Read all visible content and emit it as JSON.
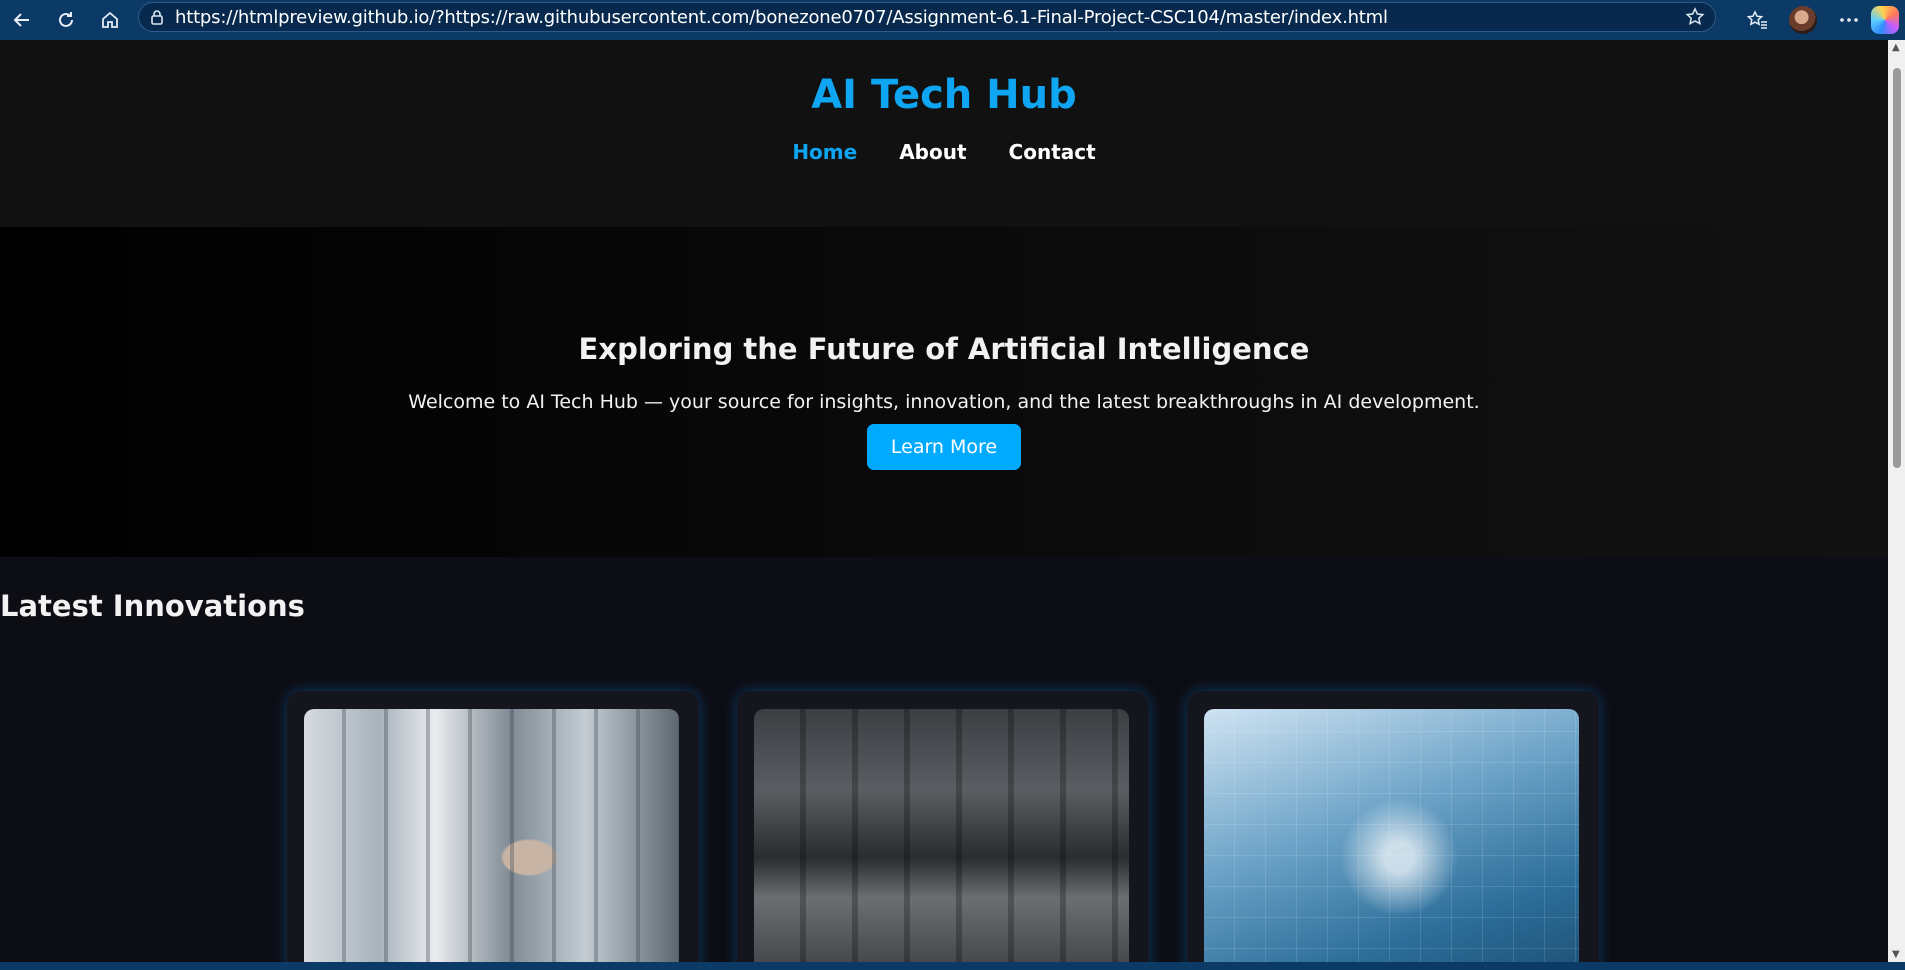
{
  "browser": {
    "url": "https://htmlpreview.github.io/?https://raw.githubusercontent.com/bonezone0707/Assignment-6.1-Final-Project-CSC104/master/index.html",
    "icons": [
      "back-icon",
      "refresh-icon",
      "home-icon",
      "lock-icon",
      "star-icon",
      "favorites-icon",
      "avatar",
      "more-icon",
      "copilot-icon"
    ]
  },
  "site": {
    "title": "AI Tech Hub",
    "nav": [
      "Home",
      "About",
      "Contact"
    ],
    "active_nav": "Home"
  },
  "hero": {
    "heading": "Exploring the Future of Artificial Intelligence",
    "text": "Welcome to AI Tech Hub — your source for insights, innovation, and the latest breakthroughs in AI development.",
    "button": "Learn More"
  },
  "innovations": {
    "heading": "Latest Innovations",
    "cards": [
      {
        "image": "engineer-lab-image"
      },
      {
        "image": "open-office-image"
      },
      {
        "image": "ai-healthcare-image"
      }
    ]
  },
  "colors": {
    "accent": "#0ea5f2",
    "button": "#00aaff",
    "browser_chrome": "#0c3a66",
    "background": "#0d0d14"
  }
}
